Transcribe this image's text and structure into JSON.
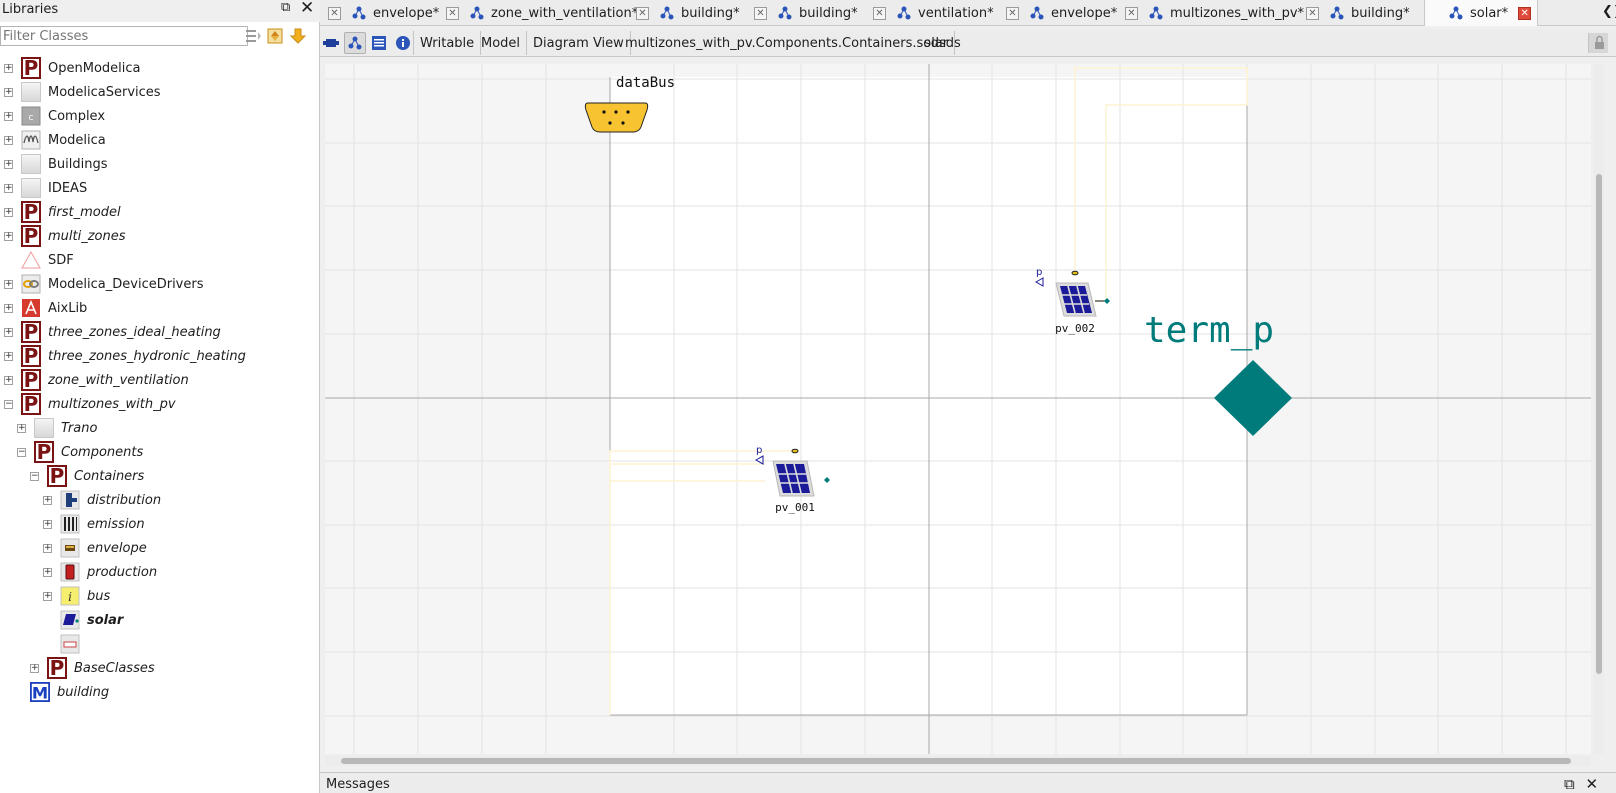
{
  "libraries": {
    "title": "Libraries",
    "filter_placeholder": "Filter Classes",
    "tree": [
      {
        "label": "OpenModelica",
        "icon": "package-icon"
      },
      {
        "label": "ModelicaServices",
        "icon": "library-icon"
      },
      {
        "label": "Complex",
        "icon": "complex-icon"
      },
      {
        "label": "Modelica",
        "icon": "modelica-icon"
      },
      {
        "label": "Buildings",
        "icon": "library-icon"
      },
      {
        "label": "IDEAS",
        "icon": "library-icon"
      },
      {
        "label": "first_model",
        "icon": "package-icon"
      },
      {
        "label": "multi_zones",
        "icon": "package-icon"
      },
      {
        "label": "SDF",
        "icon": "triangle-icon"
      },
      {
        "label": "Modelica_DeviceDrivers",
        "icon": "devicedrivers-icon"
      },
      {
        "label": "AixLib",
        "icon": "aixlib-icon"
      },
      {
        "label": "three_zones_ideal_heating",
        "icon": "package-icon"
      },
      {
        "label": "three_zones_hydronic_heating",
        "icon": "package-icon"
      },
      {
        "label": "zone_with_ventilation",
        "icon": "package-icon"
      },
      {
        "label": "multizones_with_pv",
        "icon": "package-icon"
      },
      {
        "label": "Trano",
        "icon": "library-icon"
      },
      {
        "label": "Components",
        "icon": "package-icon"
      },
      {
        "label": "Containers",
        "icon": "package-icon"
      },
      {
        "label": "distribution",
        "icon": "distribution-icon"
      },
      {
        "label": "emission",
        "icon": "emission-icon"
      },
      {
        "label": "envelope",
        "icon": "envelope-icon"
      },
      {
        "label": "production",
        "icon": "production-icon"
      },
      {
        "label": "bus",
        "icon": "bus-icon"
      },
      {
        "label": "solar",
        "icon": "solar-icon"
      },
      {
        "label": "",
        "icon": "unnamed-model-icon"
      },
      {
        "label": "BaseClasses",
        "icon": "package-icon"
      },
      {
        "label": "building",
        "icon": "model-icon"
      }
    ]
  },
  "tabs": [
    {
      "label": "envelope*"
    },
    {
      "label": "zone_with_ventilation*"
    },
    {
      "label": "building*"
    },
    {
      "label": "building*"
    },
    {
      "label": "ventilation*"
    },
    {
      "label": "envelope*"
    },
    {
      "label": "multizones_with_pv*"
    },
    {
      "label": "building*"
    },
    {
      "label": "solar*"
    }
  ],
  "toolbar": {
    "access": "Writable",
    "class_type": "Model",
    "view": "Diagram View",
    "class_path": "multizones_with_pv.Components.Containers.solar",
    "description": "sdsds"
  },
  "diagram": {
    "databus_label": "dataBus",
    "pv1_label": "pv_001",
    "pv2_label": "pv_002",
    "connector_p_label": "p",
    "terminal_label": "term_p",
    "terminal_color": "#007b7b",
    "bus_color": "#f7c331",
    "panel_color": "#1b1b9a",
    "connection_color": "#fdf3d0"
  },
  "messages": {
    "title": "Messages"
  }
}
